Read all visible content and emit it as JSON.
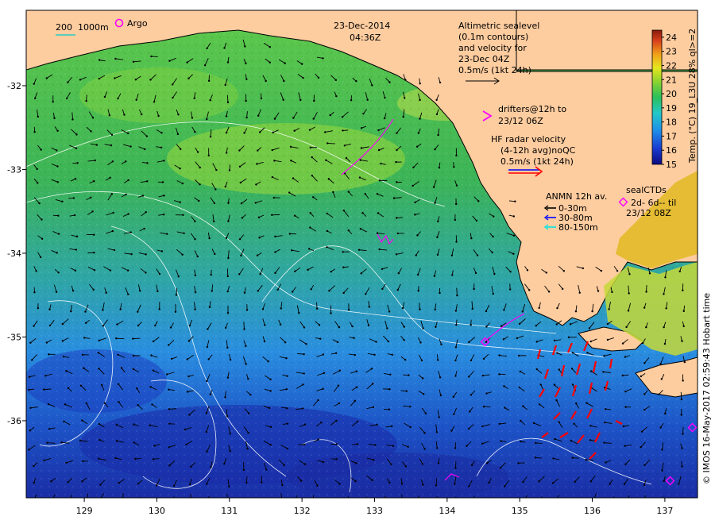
{
  "header": {
    "date": "23-Dec-2014",
    "time": "04:36Z"
  },
  "depth_legend": {
    "label_200": "200",
    "label_1000": "1000m",
    "argo_label": "Argo"
  },
  "altimetry_note": {
    "lines": [
      "Altimetric sealevel",
      "(0.1m contours)",
      "and velocity for",
      "23-Dec 04Z",
      "0.5m/s (1kt 24h)"
    ]
  },
  "drifters_note": {
    "lines": [
      "drifters@12h to",
      "23/12 06Z"
    ],
    "color": "#ff00ff"
  },
  "hf_radar_note": {
    "lines": [
      "HF radar velocity",
      "(4-12h avg)noQC",
      "0.5m/s (1kt 24h)"
    ]
  },
  "anmn_legend": {
    "title": "ANMN 12h av.",
    "items": [
      {
        "label": "0-30m",
        "color": "#000000"
      },
      {
        "label": "30-80m",
        "color": "#0000ff"
      },
      {
        "label": "80-150m",
        "color": "#00e5e5"
      }
    ]
  },
  "seal_legend": {
    "title": "sealCTDs",
    "line1": "2d- 6d-- til",
    "line2": "23/12 08Z",
    "color": "#ff00ff"
  },
  "colorbar": {
    "label": "Temp. (°C) 19_L3U 28% ql>=2",
    "ticks": [
      "24",
      "23",
      "22",
      "21",
      "20",
      "19",
      "18",
      "17",
      "16",
      "15"
    ],
    "min": 15,
    "max": 24.5
  },
  "credit": "© IMOS 16-May-2017 02:59:43 Hobart time",
  "axes": {
    "x_ticks": [
      "129",
      "130",
      "131",
      "132",
      "133",
      "134",
      "135",
      "136",
      "137"
    ],
    "y_ticks": [
      "-32",
      "-33",
      "-34",
      "-35",
      "-36"
    ],
    "x_range": [
      128.2,
      137.45
    ],
    "y_range": [
      -36.92,
      -31.1
    ]
  },
  "colors": {
    "land": "#fdcc9f",
    "sst_cool_deep": "#1c2fae",
    "sst_cool": "#1e90e6",
    "sst_mid": "#2fbf71",
    "sst_warm": "#8fd42e",
    "hf_radar_arrow": "#ff0000"
  }
}
